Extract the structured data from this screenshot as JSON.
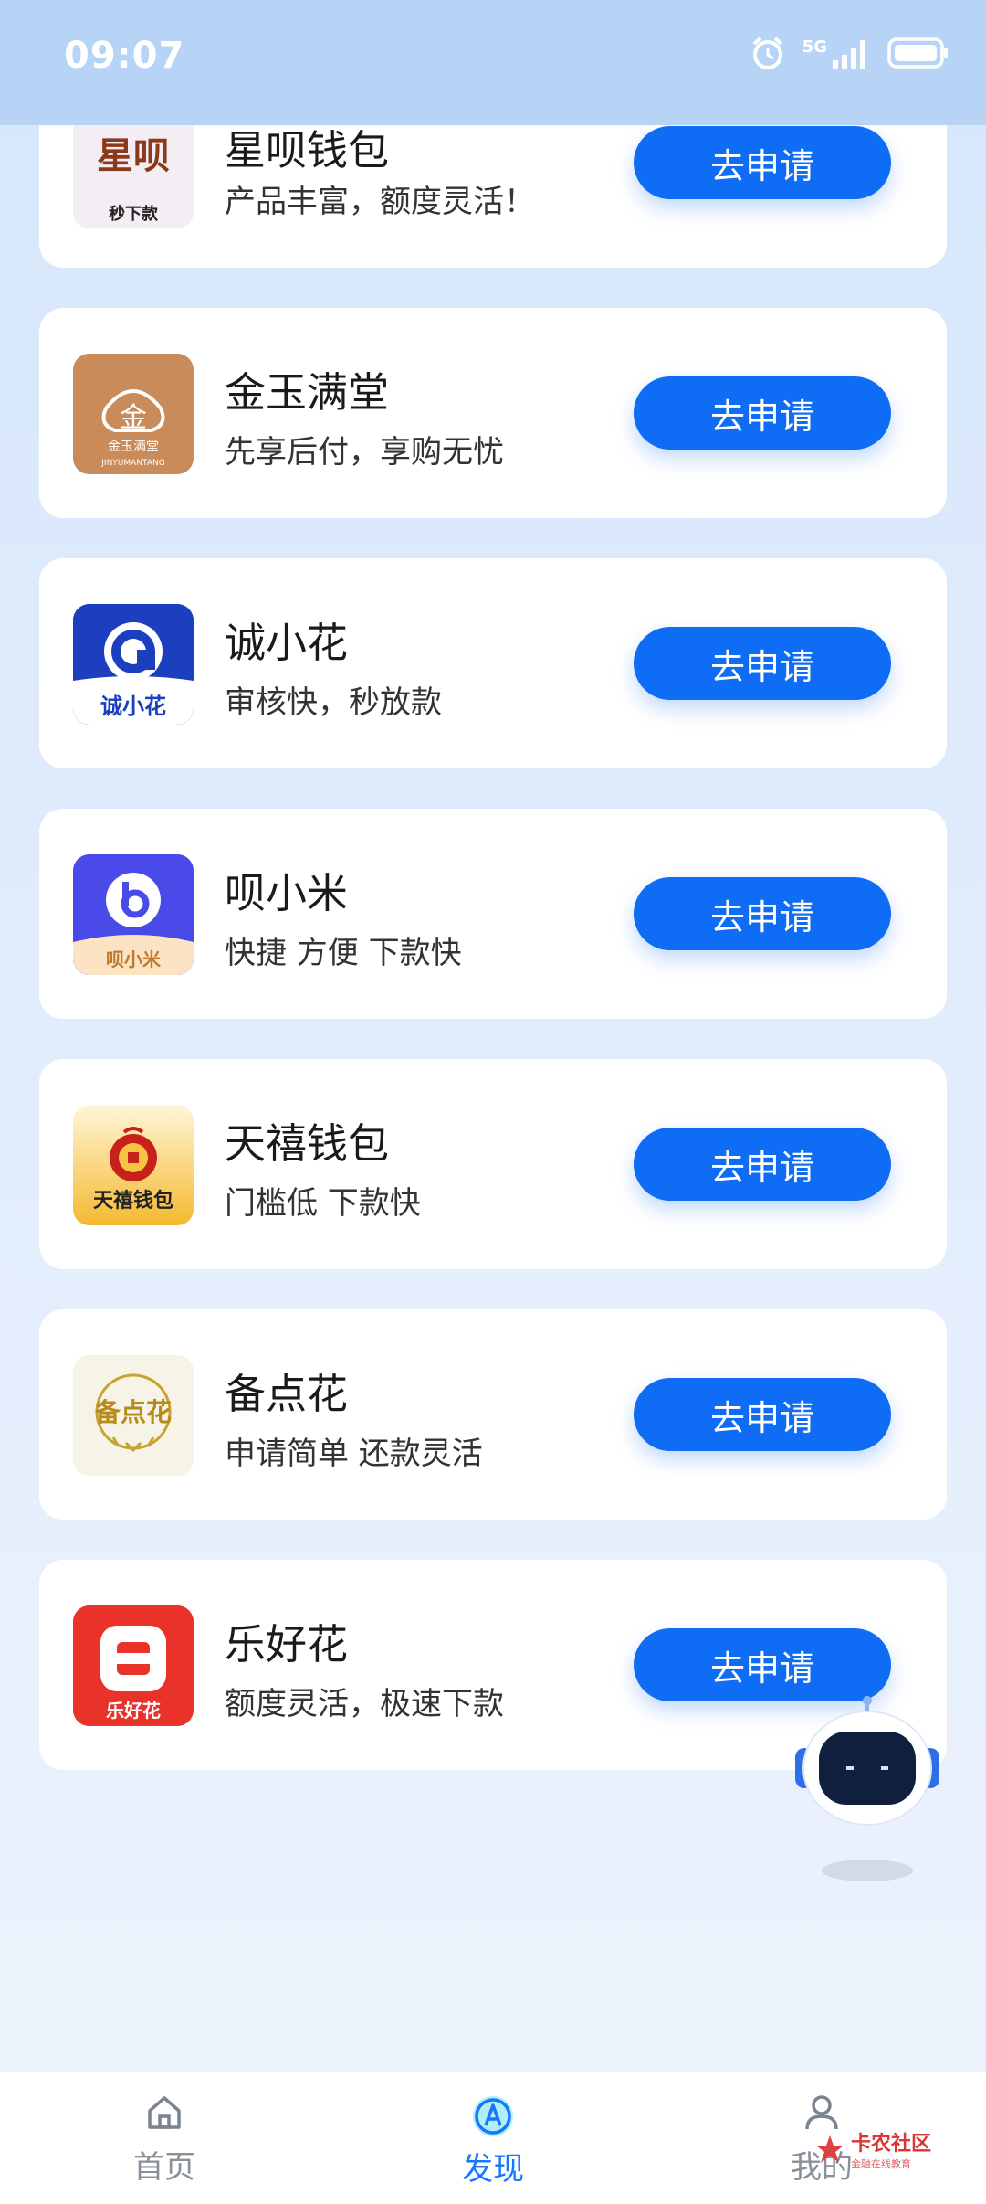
{
  "status_bar": {
    "time": "09:07",
    "network": "5G",
    "icons": [
      "alarm-icon",
      "signal-icon",
      "battery-icon"
    ]
  },
  "products": [
    {
      "name": "星呗钱包",
      "desc": "产品丰富，额度灵活！",
      "logo_icon": "xingbei-logo",
      "logo_text": "星呗",
      "logo_sub": "秒下款",
      "button": "去申请"
    },
    {
      "name": "金玉满堂",
      "desc": "先享后付，享购无忧",
      "logo_icon": "jinyumantang-logo",
      "logo_text": "金玉满堂",
      "logo_sub": "JINYUMANTANG",
      "button": "去申请"
    },
    {
      "name": "诚小花",
      "desc": "审核快，秒放款",
      "logo_icon": "chengxiaohua-logo",
      "logo_text": "诚小花",
      "button": "去申请"
    },
    {
      "name": "呗小米",
      "desc": "快捷 方便 下款快",
      "logo_icon": "beixiaomi-logo",
      "logo_text": "呗小米",
      "button": "去申请"
    },
    {
      "name": "天禧钱包",
      "desc": "门槛低 下款快",
      "logo_icon": "tianxi-logo",
      "logo_text": "天禧钱包",
      "button": "去申请"
    },
    {
      "name": "备点花",
      "desc": "申请简单 还款灵活",
      "logo_icon": "beidianhua-logo",
      "logo_text": "备点花",
      "button": "去申请"
    },
    {
      "name": "乐好花",
      "desc": "额度灵活，极速下款",
      "logo_icon": "lehaohua-logo",
      "logo_text": "乐好花",
      "button": "去申请"
    }
  ],
  "tabs": [
    {
      "label": "首页",
      "icon": "home-icon",
      "active": false
    },
    {
      "label": "发现",
      "icon": "discover-icon",
      "active": true
    },
    {
      "label": "我的",
      "icon": "profile-icon",
      "active": false
    }
  ],
  "watermark": {
    "title": "卡农社区",
    "subtitle": "金融在线教育"
  },
  "colors": {
    "accent": "#0f6cf5",
    "active_tab": "#1677ff",
    "status_bar": "#b7d3f6"
  }
}
